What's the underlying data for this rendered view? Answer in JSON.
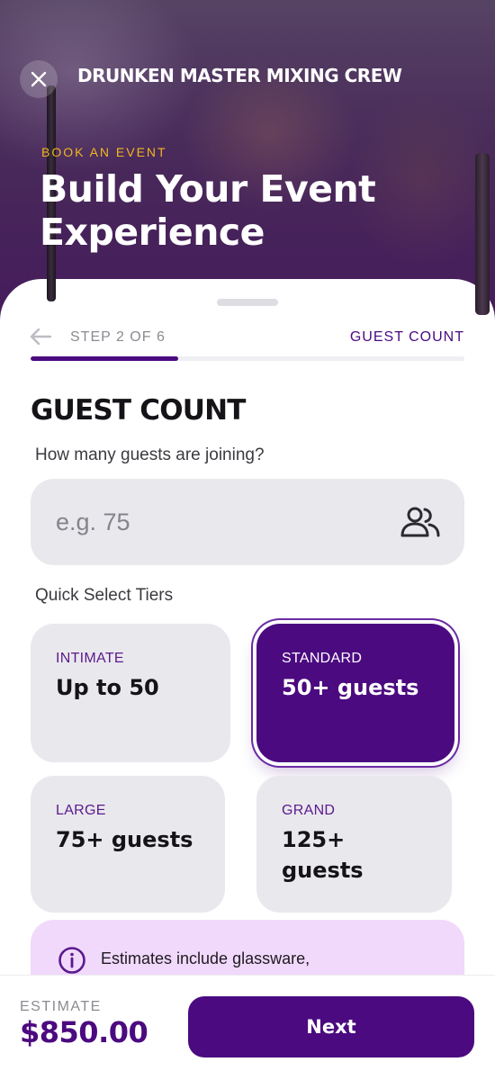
{
  "header": {
    "brand": "DRUNKEN MASTER MIXING CREW",
    "eyebrow": "BOOK AN EVENT",
    "title": "Build Your Event Experience",
    "close_icon": "close-icon"
  },
  "progress": {
    "step_label": "STEP 2 OF 6",
    "step_name": "GUEST COUNT",
    "fraction": 0.34,
    "back_icon": "arrow-left-icon"
  },
  "guest_count": {
    "title": "GUEST COUNT",
    "question": "How many guests are joining?",
    "input_value": "",
    "input_placeholder": "e.g. 75",
    "input_icon": "users-icon"
  },
  "tiers": {
    "label": "Quick Select Tiers",
    "items": [
      {
        "name": "INTIMATE",
        "value": "Up to 50",
        "selected": false
      },
      {
        "name": "STANDARD",
        "value": "50+ guests",
        "selected": true
      },
      {
        "name": "LARGE",
        "value": "75+ guests",
        "selected": false
      },
      {
        "name": "GRAND",
        "value": "125+ guests",
        "selected": false
      }
    ]
  },
  "info": {
    "icon": "info-icon",
    "text": "Estimates include glassware,"
  },
  "footer": {
    "estimate_label": "ESTIMATE",
    "estimate_value": "$850.00",
    "next_label": "Next"
  },
  "colors": {
    "brand_purple": "#4b0a80",
    "accent_gold": "#f2b51f",
    "card_gray": "#e9e8ed",
    "info_bg": "#f1d9fb"
  }
}
